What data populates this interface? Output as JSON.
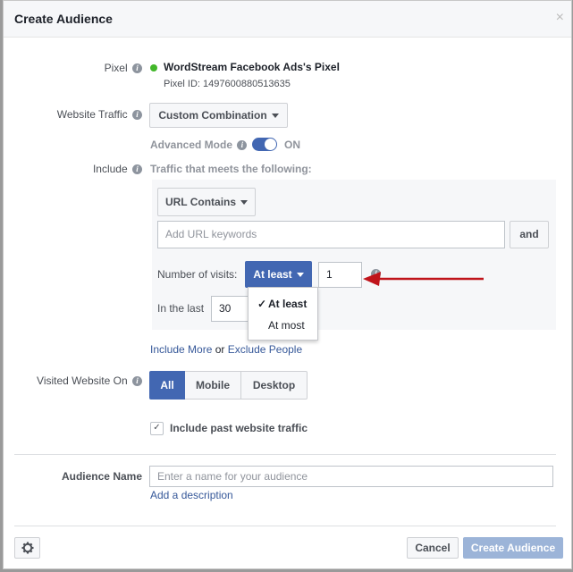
{
  "dialog": {
    "title": "Create Audience",
    "close_glyph": "×"
  },
  "pixel": {
    "label": "Pixel",
    "name": "WordStream Facebook Ads's Pixel",
    "id_text": "Pixel ID: 1497600880513635",
    "status_color": "#42b72a"
  },
  "website_traffic": {
    "label": "Website Traffic",
    "selected": "Custom Combination"
  },
  "advanced_mode": {
    "label": "Advanced Mode",
    "state_text": "ON"
  },
  "include": {
    "label": "Include",
    "description": "Traffic that meets the following:",
    "rule_type": "URL Contains",
    "keywords_placeholder": "Add URL keywords",
    "and_label": "and",
    "visits_label": "Number of visits:",
    "visits_operator": "At least",
    "visits_value": "1",
    "in_last_label": "In the last",
    "in_last_value": "30",
    "operator_options": [
      "At least",
      "At most"
    ],
    "selected_option_check": "✓",
    "include_more": "Include More",
    "or_text": "or",
    "exclude_people": "Exclude People"
  },
  "visited_on": {
    "label": "Visited Website On",
    "options": [
      "All",
      "Mobile",
      "Desktop"
    ]
  },
  "past_traffic": {
    "label": "Include past website traffic",
    "check_glyph": "✓"
  },
  "audience_name": {
    "label": "Audience Name",
    "placeholder": "Enter a name for your audience",
    "add_description": "Add a description"
  },
  "footer": {
    "cancel": "Cancel",
    "create": "Create Audience"
  },
  "colors": {
    "accent": "#4267b2",
    "annotation_arrow": "#c0141b"
  }
}
